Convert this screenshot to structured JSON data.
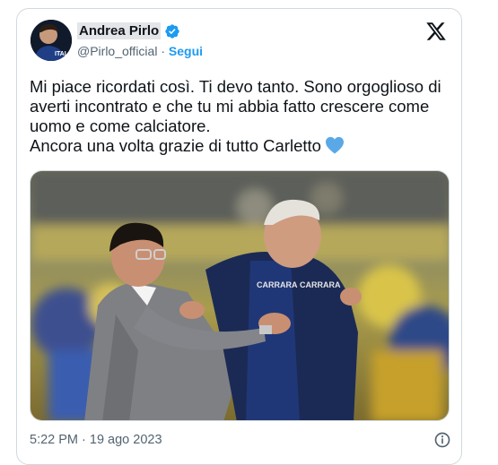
{
  "author": {
    "display_name": "Andrea Pirlo",
    "handle": "@Pirlo_official",
    "separator": " · ",
    "follow_label": "Segui",
    "verified": true,
    "verified_color": "#1d9bf0",
    "avatar_jersey_text": "ITAL"
  },
  "tweet": {
    "lines": [
      "Mi piace ricordati così. Ti devo tanto. Sono orgoglioso di averti incontrato e che tu mi abbia fatto crescere come uomo e come calciatore.",
      "Ancora una volta grazie di tutto Carletto"
    ],
    "emoji": "blue-heart-icon",
    "emoji_color": "#5aa9e6"
  },
  "media": {
    "shirt_text_1": "CARRARA",
    "shirt_text_2": "CARRARA"
  },
  "footer": {
    "timestamp": "5:22 PM · 19 ago 2023"
  },
  "icons": {
    "brand": "x-logo-icon",
    "info": "info-icon",
    "verified": "verified-badge-icon"
  },
  "colors": {
    "text": "#0f1419",
    "muted": "#536471",
    "link": "#1d9bf0",
    "border": "#cfd9de"
  }
}
